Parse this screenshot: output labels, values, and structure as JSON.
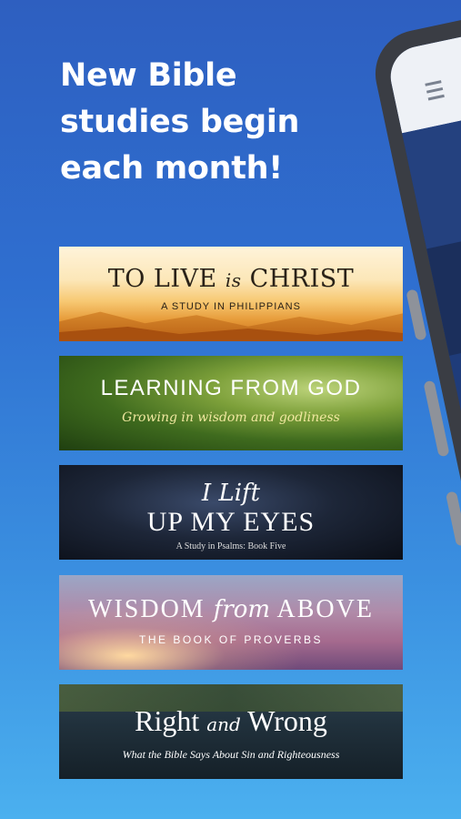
{
  "headline": {
    "line1": "New Bible",
    "line2": "studies begin",
    "line3": "each month!"
  },
  "studies": [
    {
      "title_a": "TO LIVE ",
      "title_em": "is",
      "title_b": " CHRIST",
      "subtitle": "A STUDY IN PHILIPPIANS"
    },
    {
      "title": "LEARNING FROM GOD",
      "subtitle": "Growing in wisdom and godliness"
    },
    {
      "title_line1": "I Lift",
      "title_line2": "UP MY EYES",
      "subtitle": "A Study in Psalms: Book Five"
    },
    {
      "title_a": "WISDOM ",
      "title_em": "from",
      "title_b": " ABOVE",
      "subtitle": "THE BOOK OF PROVERBS"
    },
    {
      "title_a": "Right ",
      "title_em": "and",
      "title_b": " Wrong",
      "subtitle": "What the Bible Says About Sin and Righteousness"
    }
  ],
  "colors": {
    "background_top": "#2e5fc0",
    "background_bottom": "#4bb0ef",
    "phone_frame": "#3a3d44"
  },
  "icons": [
    "menu-icon"
  ]
}
